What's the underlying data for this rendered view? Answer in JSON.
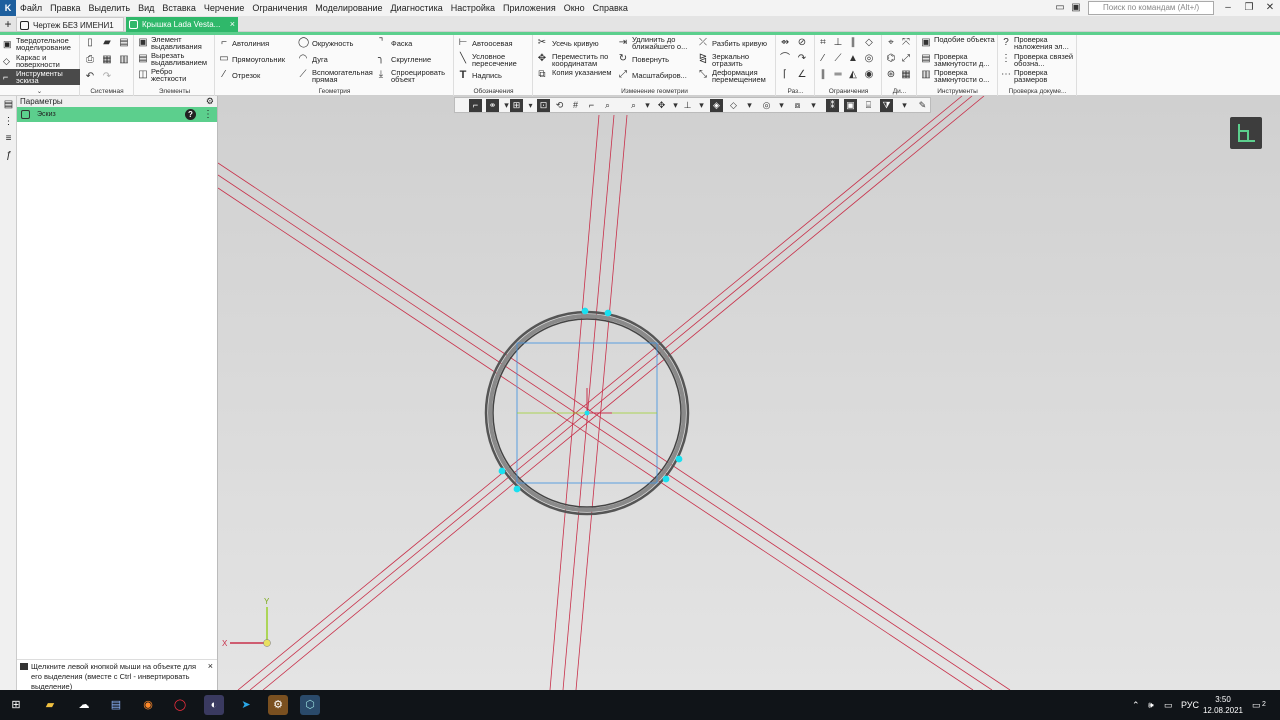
{
  "app": {
    "logo": "K"
  },
  "menu": [
    "Файл",
    "Правка",
    "Выделить",
    "Вид",
    "Вставка",
    "Черчение",
    "Ограничения",
    "Моделирование",
    "Диагностика",
    "Настройка",
    "Приложения",
    "Окно",
    "Справка"
  ],
  "search": {
    "placeholder": "Поиск по командам (Alt+/)"
  },
  "tabs": {
    "drawing": "Чертеж БЕЗ ИМЕНИ1",
    "part": "Крышка Lada Vesta...",
    "close": "×"
  },
  "modes": [
    "Твердотельное моделирование",
    "Каркас и поверхности",
    "Инструменты эскиза"
  ],
  "groups": {
    "system": {
      "title": "Системная"
    },
    "elements": {
      "title": "Элементы",
      "items": [
        "Элемент выдавливания",
        "Вырезать выдавливанием",
        "Ребро жесткости"
      ]
    },
    "geometry": {
      "title": "Геометрия",
      "items": [
        "Автолиния",
        "Окружность",
        "Фаска",
        "Прямоугольник",
        "Дуга",
        "Скругление",
        "Отрезок",
        "Вспомогательная прямая",
        "Спроецировать объект"
      ]
    },
    "designations": {
      "title": "Обозначения",
      "items": [
        "Автоосевая",
        "Условное пересечение",
        "Надпись"
      ]
    },
    "edit": {
      "title": "Изменение геометрии",
      "items": [
        "Усечь кривую",
        "Удлинить до ближайшего о...",
        "Разбить кривую",
        "Переместить по координатам",
        "Повернуть",
        "Зеркально отразить",
        "Копия указанием",
        "Масштабиров...",
        "Деформация перемещением"
      ]
    },
    "dims": {
      "title": "Раз..."
    },
    "constraints": {
      "title": "Ограничения"
    },
    "diag": {
      "title": "Ди..."
    },
    "tools": {
      "title": "Инструменты",
      "items": [
        "Подобие объекта",
        "Проверка замкнутости д...",
        "Проверка замкнутости о..."
      ]
    },
    "docs": {
      "title": "Проверка докуме...",
      "items": [
        "Проверка наложения эл...",
        "Проверка связей обозна...",
        "Проверка размеров"
      ]
    }
  },
  "panel": {
    "title": "Параметры",
    "sketch": "Эскиз",
    "help": "?"
  },
  "hint": {
    "text": "Щелкните левой кнопкой мыши на объекте для его выделения (вместе с Ctrl - инвертировать выделение)",
    "close": "×"
  },
  "axes": {
    "x": "X",
    "y": "Y"
  },
  "tray": {
    "lang": "РУС",
    "time": "3:50",
    "date": "12.08.2021",
    "notify": "2"
  },
  "colors": {
    "accent": "#2fb86a",
    "panel_green": "#5ccf8d",
    "construction": "#c8304a",
    "rect": "#3a8fe0",
    "point": "#19e0f0"
  }
}
